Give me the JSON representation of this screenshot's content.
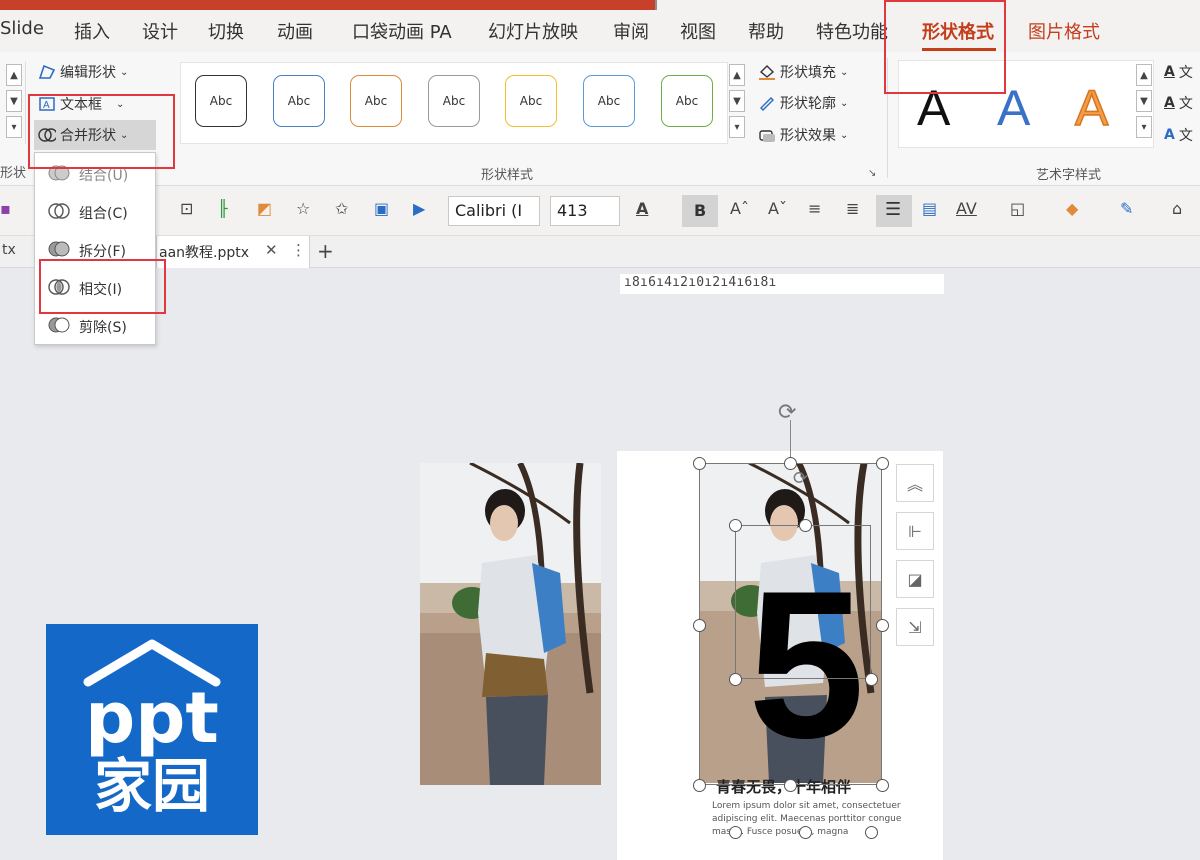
{
  "menubar": {
    "tabs": [
      "Slide",
      "插入",
      "设计",
      "切换",
      "动画",
      "口袋动画 PA",
      "幻灯片放映",
      "审阅",
      "视图",
      "帮助",
      "特色功能",
      "形状格式",
      "图片格式"
    ],
    "active_tab": "形状格式"
  },
  "ribbon": {
    "insert_shapes": {
      "edit_shape": "编辑形状",
      "text_box": "文本框",
      "merge_shapes": "合并形状",
      "group_label": "形状"
    },
    "shape_styles": {
      "swatch_text": "Abc",
      "fill": "形状填充",
      "outline": "形状轮廓",
      "effects": "形状效果",
      "group_label": "形状样式"
    },
    "wordart": {
      "letter": "A",
      "group_label": "艺术字样式",
      "side_items": [
        "文",
        "文",
        "文"
      ]
    }
  },
  "toolbar": {
    "font_name": "Calibri (I",
    "font_size": "413",
    "bold": "B",
    "char_spacing": "AV"
  },
  "doc_tab": {
    "left_fragment": "tx",
    "title": "aan教程.pptx",
    "add": "+"
  },
  "merge_menu": {
    "items": [
      {
        "label": "结合(U)"
      },
      {
        "label": "组合(C)"
      },
      {
        "label": "拆分(F)"
      },
      {
        "label": "相交(I)"
      },
      {
        "label": "剪除(S)"
      }
    ]
  },
  "ruler": {
    "text": "ı8ı6ı4ı2ı0ı2ı4ı6ı8ı"
  },
  "slide": {
    "big_number": "5",
    "slogan": "青春无畏，十年相伴",
    "body": "Lorem ipsum dolor sit amet, consectetuer adipiscing elit. Maecenas porttitor congue massa. Fusce posuere, magna"
  },
  "logo": {
    "line1": "ppt",
    "line2": "家园"
  },
  "colors": {
    "accent": "#c43e1c",
    "highlight": "#e0383e",
    "logo_bg": "#1468c8"
  }
}
